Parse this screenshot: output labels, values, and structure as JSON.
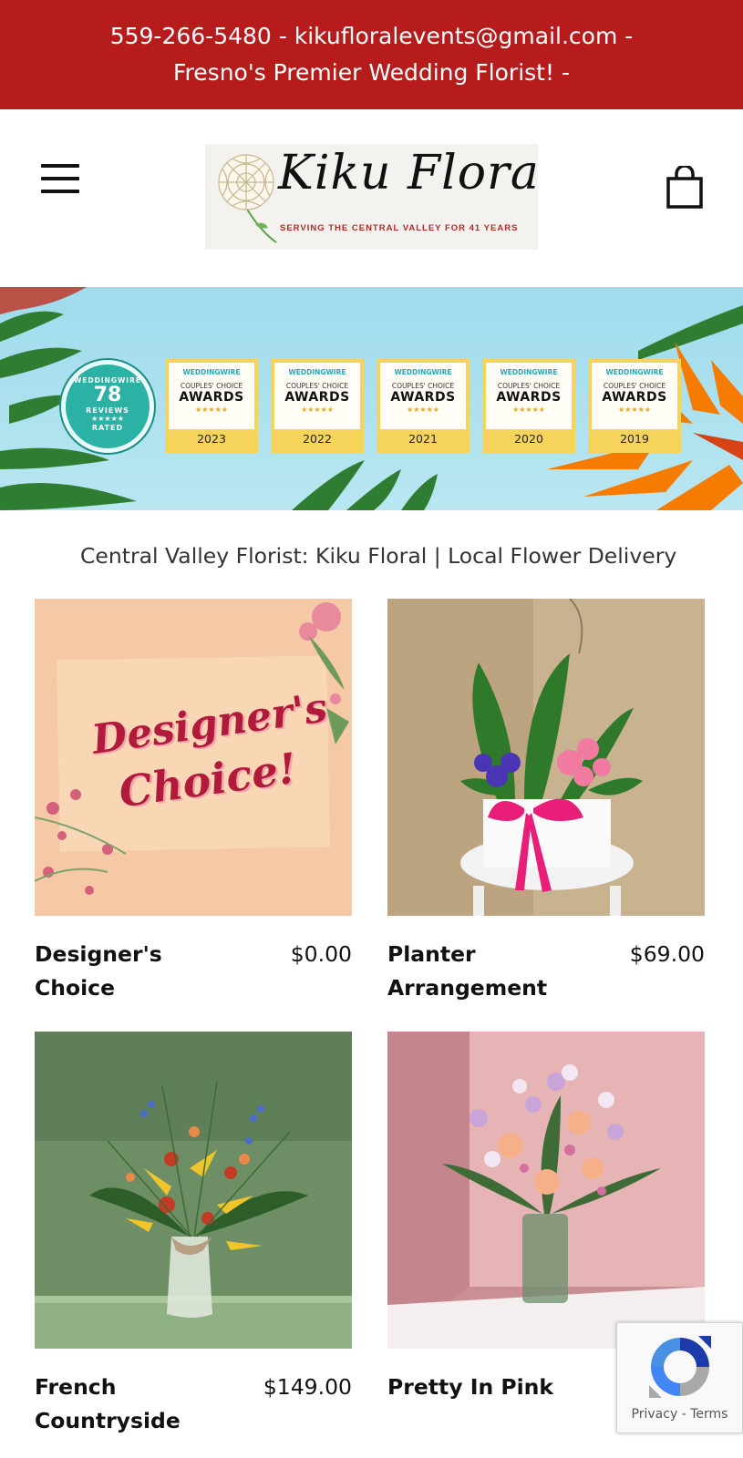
{
  "topbar": {
    "line1": "559-266-5480 - kikufloralevents@gmail.com -",
    "line2": "Fresno's Premier Wedding Florist! -"
  },
  "header": {
    "logo_name": "Kiku Floral",
    "logo_tagline": "SERVING THE CENTRAL VALLEY FOR 41 YEARS"
  },
  "banner": {
    "rated": {
      "top_text": "WEDDINGWIRE",
      "count": "78",
      "label": "REVIEWS",
      "stars": "★★★★★",
      "bottom_text": "RATED"
    },
    "awards": [
      {
        "brand": "WEDDINGWIRE",
        "line": "COUPLES' CHOICE",
        "title": "AWARDS",
        "stars": "★★★★★",
        "year": "2023"
      },
      {
        "brand": "WEDDINGWIRE",
        "line": "COUPLES' CHOICE",
        "title": "AWARDS",
        "stars": "★★★★★",
        "year": "2022"
      },
      {
        "brand": "WEDDINGWIRE",
        "line": "COUPLES' CHOICE",
        "title": "AWARDS",
        "stars": "★★★★★",
        "year": "2021"
      },
      {
        "brand": "WEDDINGWIRE",
        "line": "COUPLES' CHOICE",
        "title": "AWARDS",
        "stars": "★★★★★",
        "year": "2020"
      },
      {
        "brand": "WEDDINGWIRE",
        "line": "COUPLES' CHOICE",
        "title": "AWARDS",
        "stars": "★★★★★",
        "year": "2019"
      }
    ]
  },
  "page_heading": "Central Valley Florist: Kiku Floral | Local Flower Delivery",
  "products": [
    {
      "name": "Designer's Choice",
      "price": "$0.00",
      "image_text_1": "Designer's",
      "image_text_2": "Choice!"
    },
    {
      "name": "Planter Arrangement",
      "price": "$69.00"
    },
    {
      "name": "French Countryside",
      "price": "$149.00"
    },
    {
      "name": "Pretty In Pink",
      "price": ""
    }
  ],
  "recaptcha": {
    "privacy": "Privacy",
    "separator": " - ",
    "terms": "Terms"
  },
  "colors": {
    "topbar_bg": "#b71c1c",
    "award_gold": "#f6d35a",
    "rated_teal": "#2bb2a5",
    "banner_sky": "#a8dfee"
  },
  "icons": [
    "hamburger-menu-icon",
    "shopping-bag-icon",
    "chrysanthemum-logo-icon",
    "recaptcha-icon"
  ]
}
